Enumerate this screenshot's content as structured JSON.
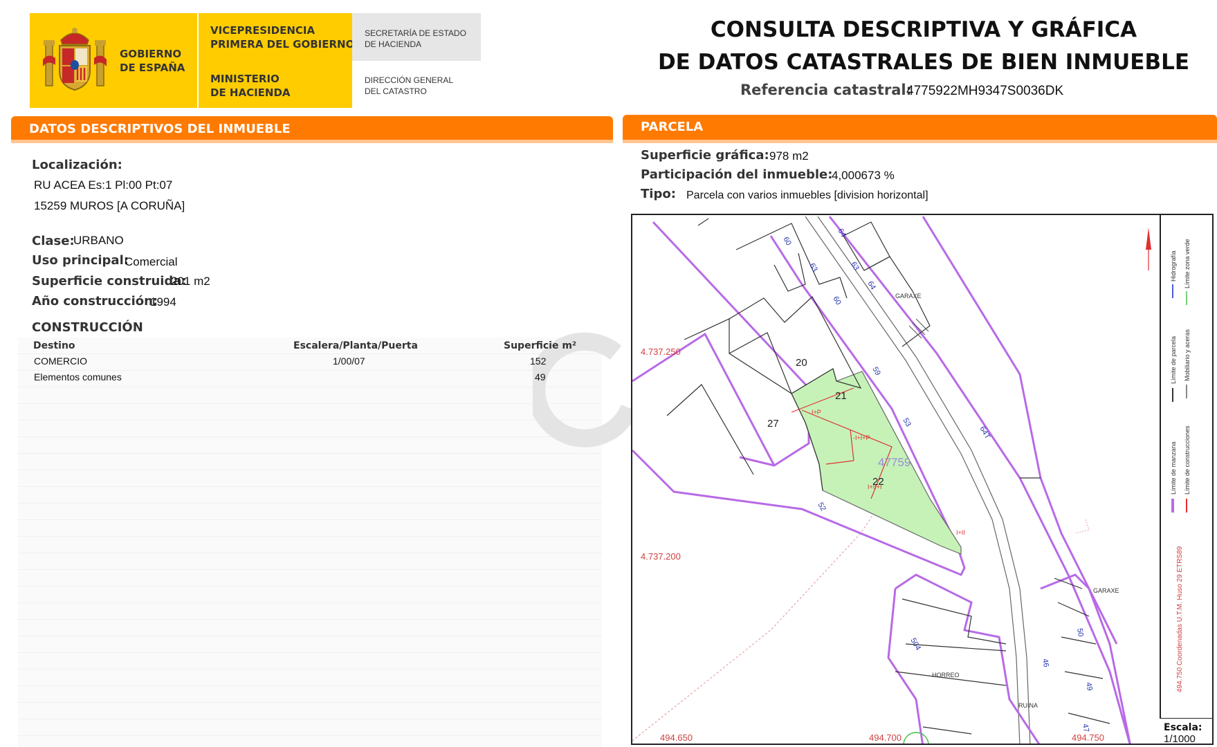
{
  "header": {
    "gov_name": [
      "GOBIERNO",
      "DE ESPAÑA"
    ],
    "vicepresidencia": [
      "VICEPRESIDENCIA",
      "PRIMERA DEL GOBIERNO"
    ],
    "ministerio": [
      "MINISTERIO",
      "DE HACIENDA"
    ],
    "secretaria": [
      "SECRETARÍA DE ESTADO",
      "DE HACIENDA"
    ],
    "direccion": [
      "DIRECCIÓN GENERAL",
      "DEL CATASTRO"
    ],
    "title_line1": "CONSULTA DESCRIPTIVA Y GRÁFICA",
    "title_line2": "DE DATOS CATASTRALES DE BIEN INMUEBLE",
    "ref_label": "Referencia catastral:",
    "ref_value": "4775922MH9347S0036DK"
  },
  "left": {
    "section_title": "DATOS DESCRIPTIVOS DEL INMUEBLE",
    "localizacion_label": "Localización:",
    "localizacion_line1": "RU ACEA  Es:1 Pl:00 Pt:07",
    "localizacion_line2": "15259 MUROS [A CORUÑA]",
    "clase_label": "Clase:",
    "clase_value": "URBANO",
    "uso_label": "Uso principal:",
    "uso_value": "Comercial",
    "superficie_label": "Superficie construida:",
    "superficie_value": "201 m2",
    "ano_label": "Año construcción:",
    "ano_value": "1994",
    "construccion_title": "CONSTRUCCIÓN",
    "table": {
      "headers": [
        "Destino",
        "Escalera/Planta/Puerta",
        "Superficie m²"
      ],
      "rows": [
        [
          "COMERCIO",
          "1/00/07",
          "152"
        ],
        [
          "Elementos comunes",
          "",
          "49"
        ]
      ]
    }
  },
  "right": {
    "section_title": "PARCELA",
    "sup_grafica_label": "Superficie gráfica:",
    "sup_grafica_value": "978 m2",
    "participacion_label": "Participación del inmueble:",
    "participacion_value": "4,000673 %",
    "tipo_label": "Tipo:",
    "tipo_value": "Parcela con varios inmuebles [division horizontal]"
  },
  "map": {
    "coord_y1": "4.737.250",
    "coord_y2": "4.737.200",
    "coord_x1": "494.650",
    "coord_x2": "494.700",
    "coord_x3": "494.750",
    "parcel_ref": "47759",
    "labels": {
      "b20": "20",
      "b21": "21",
      "b22": "22",
      "b27": "27",
      "garaxe1": "GARAXE",
      "garaxe2": "GARAXE",
      "horreo": "HORREO",
      "ruina": "RUINA",
      "f1": "I+P",
      "f2": "-I+I+P",
      "f3": "I+II+I",
      "f4": "I+II"
    },
    "street_numbers": [
      "60",
      "63",
      "64",
      "63",
      "64",
      "60",
      "59",
      "53",
      "64T",
      "52",
      "50",
      "504",
      "46",
      "49",
      "47"
    ],
    "legend": {
      "hidrografia": "Hidrografía",
      "limite_zona_verde": "Límite zona verde",
      "limite_parcela": "Límite de parcela",
      "mobiliario": "Mobiliario y aceras",
      "limite_manzana": "Límite de manzana",
      "limite_construcciones": "Límite de construcciones",
      "coords_text": "494.750 Coordenadas U.T.M. Huso 29 ETRS89"
    },
    "escala_label": "Escala:",
    "escala_value": "1/1000",
    "colors": {
      "manzana": "#b86ae6",
      "parcela_fill": "#c6f2b8",
      "construccion": "#e03030",
      "coord_text": "#d04040"
    }
  }
}
